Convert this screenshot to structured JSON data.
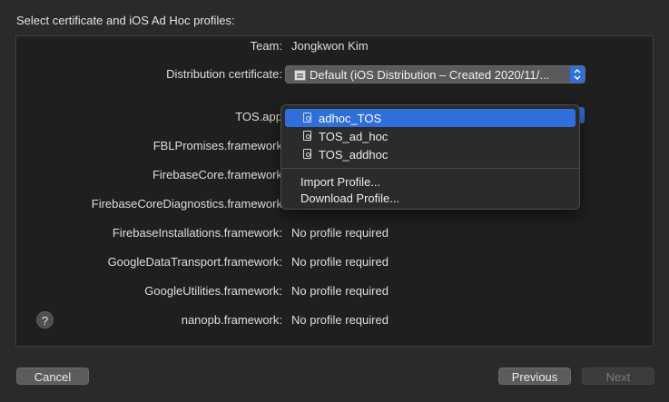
{
  "heading": "Select certificate and iOS Ad Hoc profiles:",
  "rows": {
    "team": {
      "label": "Team:",
      "value": "Jongkwon Kim"
    },
    "cert": {
      "label": "Distribution certificate:",
      "value": "Default (iOS Distribution – Created 2020/11/..."
    },
    "tos": {
      "label": "TOS.app"
    },
    "fbl": {
      "label": "FBLPromises.framework"
    },
    "fbcore": {
      "label": "FirebaseCore.framework"
    },
    "fbdiag": {
      "label": "FirebaseCoreDiagnostics.framework"
    },
    "fbinst": {
      "label": "FirebaseInstallations.framework:",
      "value": "No profile required"
    },
    "gdt": {
      "label": "GoogleDataTransport.framework:",
      "value": "No profile required"
    },
    "gutil": {
      "label": "GoogleUtilities.framework:",
      "value": "No profile required"
    },
    "nanopb": {
      "label": "nanopb.framework:",
      "value": "No profile required"
    }
  },
  "menu": {
    "items": [
      "adhoc_TOS",
      "TOS_ad_hoc",
      "TOS_addhoc"
    ],
    "selected": "adhoc_TOS",
    "actions": [
      "Import Profile...",
      "Download Profile..."
    ]
  },
  "help": "?",
  "buttons": {
    "cancel": "Cancel",
    "previous": "Previous",
    "next": "Next"
  },
  "colors": {
    "accent": "#2f6fdc",
    "background": "#2a2a2c",
    "panel": "#1f1f20"
  }
}
